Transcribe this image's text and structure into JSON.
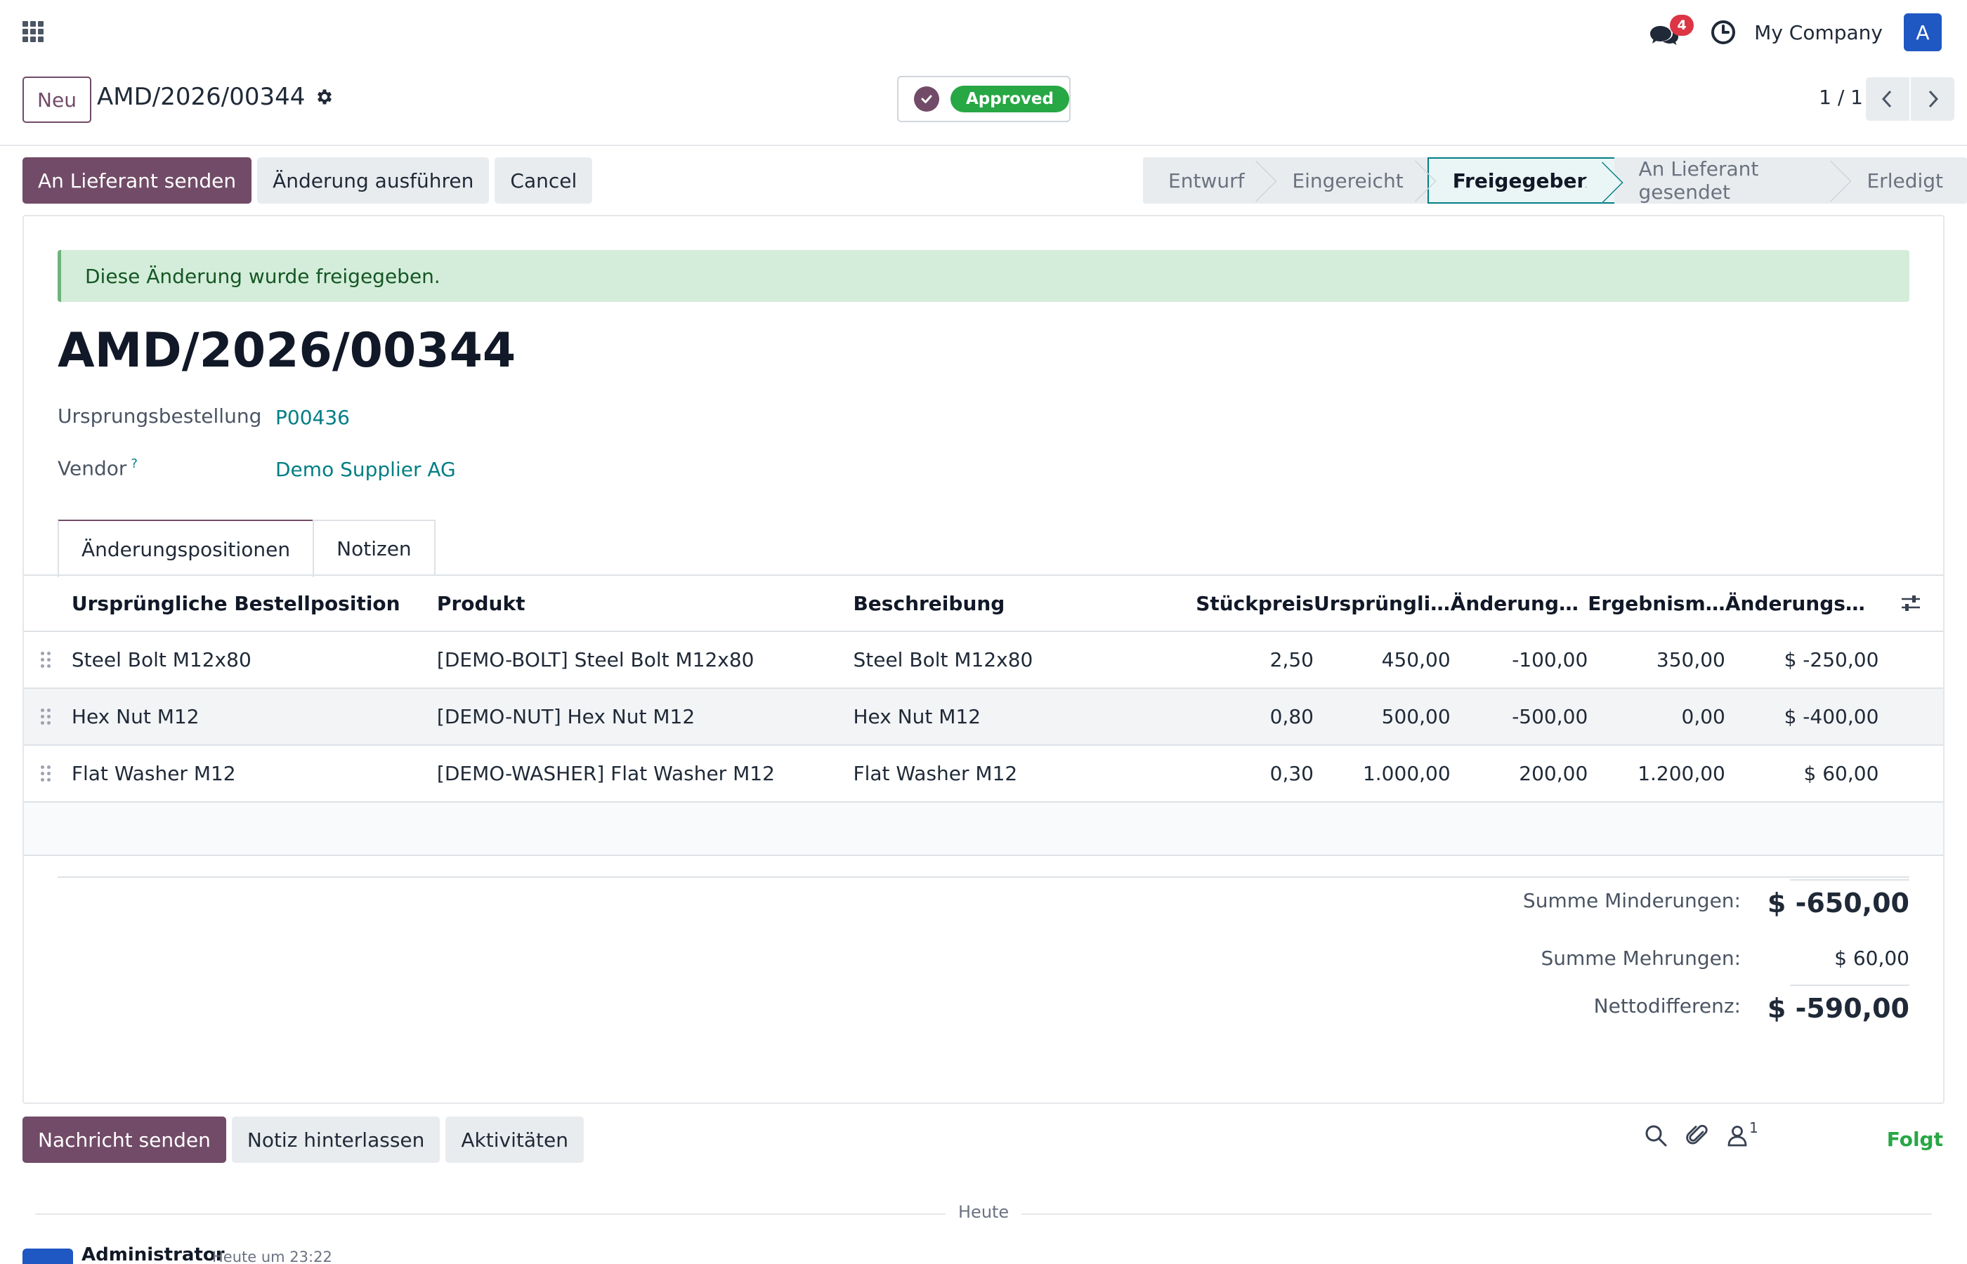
{
  "navbar": {
    "chat_count": "4",
    "company": "My Company",
    "user_initial": "A"
  },
  "control_panel": {
    "new_label": "Neu",
    "breadcrumb": "AMD/2026/00344",
    "status_badge": "Approved",
    "pager": "1 / 1"
  },
  "actions": {
    "send_vendor": "An Lieferant senden",
    "apply_change": "Änderung ausführen",
    "cancel": "Cancel"
  },
  "statusbar": {
    "steps": [
      "Entwurf",
      "Eingereicht",
      "Freigegeben",
      "An Lieferant gesendet",
      "Erledigt"
    ],
    "active_index": 2
  },
  "sheet": {
    "alert": "Diese Änderung wurde freigegeben.",
    "title": "AMD/2026/00344",
    "origin_label": "Ursprungsbestellung",
    "origin_value": "P00436",
    "vendor_label": "Vendor",
    "vendor_help": "?",
    "vendor_value": "Demo Supplier AG"
  },
  "tabs": [
    "Änderungspositionen",
    "Notizen"
  ],
  "table": {
    "headers": [
      "Ursprüngliche Bestellposition",
      "Produkt",
      "Beschreibung",
      "Stückpreis",
      "Ursprünglic...",
      "Änderungs...",
      "Ergebnisme...",
      "Änderungsbe..."
    ],
    "rows": [
      [
        "Steel Bolt M12x80",
        "[DEMO-BOLT] Steel Bolt M12x80",
        "Steel Bolt M12x80",
        "2,50",
        "450,00",
        "-100,00",
        "350,00",
        "$ -250,00"
      ],
      [
        "Hex Nut M12",
        "[DEMO-NUT] Hex Nut M12",
        "Hex Nut M12",
        "0,80",
        "500,00",
        "-500,00",
        "0,00",
        "$ -400,00"
      ],
      [
        "Flat Washer M12",
        "[DEMO-WASHER] Flat Washer M12",
        "Flat Washer M12",
        "0,30",
        "1.000,00",
        "200,00",
        "1.200,00",
        "$ 60,00"
      ]
    ]
  },
  "totals": {
    "decrease_label": "Summe Minderungen:",
    "decrease_value": "$ -650,00",
    "increase_label": "Summe Mehrungen:",
    "increase_value": "$ 60,00",
    "net_label": "Nettodifferenz:",
    "net_value": "$ -590,00"
  },
  "chatter": {
    "send_message": "Nachricht senden",
    "log_note": "Notiz hinterlassen",
    "activities": "Aktivitäten",
    "follower_count": "1",
    "follow": "Folgt",
    "separator": "Heute",
    "author": "Administrator",
    "time": "Heute um 23:22"
  },
  "colors": {
    "primary": "#714b67",
    "teal": "#017e84",
    "success": "#28a745",
    "alert_bg": "#d4edda"
  }
}
